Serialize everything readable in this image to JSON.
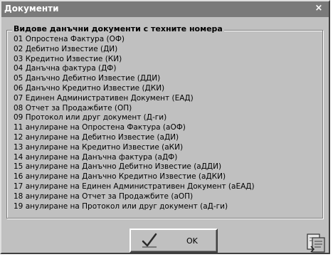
{
  "window": {
    "title": "Документи",
    "close_symbol": "×"
  },
  "group": {
    "title": "Видове данъчни документи с техните номера",
    "items": [
      "01 Опростена Фактура (ОФ)",
      "02 Дебитно Известие (ДИ)",
      "03 Кредитно Известие (КИ)",
      "04 Данъчна фактура (ДФ)",
      "05 Данъчно Дебитно Известие (ДДИ)",
      "06 Данъчно Кредитно Известие (ДКИ)",
      "07 Единен Административен Документ (ЕАД)",
      "08 Отчет за Продажбите (ОП)",
      "09 Протокол или друг документ (Д-ги)",
      "11 анулиране на Опростена Фактура (аОФ)",
      "12 анулиране на Дебитно Известие (аДИ)",
      "13 анулиране на Кредитно Известие (аКИ)",
      "14 анулиране на Данъчна фактура (аДФ)",
      "15 анулиране на Данъчно Дебитно Известие (аДДИ)",
      "16 анулиране на Данъчно Кредитно Известие (аДКИ)",
      "17 анулиране на Единен Административен Документ (аЕАД)",
      "18 анулиране на Отчет за Продажбите (аОП)",
      "19 анулиране на Протокол или друг документ (аД-ги)"
    ]
  },
  "footer": {
    "ok_label": "OK",
    "ok_icon": "checkmark-icon",
    "corner_icon": "document-copy-icon"
  }
}
